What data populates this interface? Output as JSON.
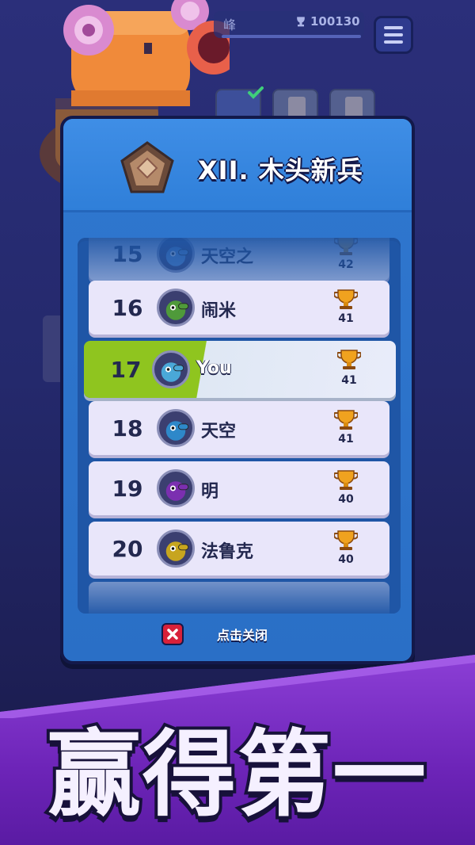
{
  "background": {
    "player_name_partial": "峰",
    "trophy_total": "100130"
  },
  "panel": {
    "title": "XII. 木头新兵",
    "close_label": "点击关闭"
  },
  "leaderboard": {
    "rows": [
      {
        "rank": "15",
        "name": "天空之",
        "score": "42",
        "avatar_color": "#5c8fd0"
      },
      {
        "rank": "16",
        "name": "闹米",
        "score": "41",
        "avatar_color": "#4f9a3a"
      },
      {
        "rank": "17",
        "name": "You",
        "score": "41",
        "avatar_color": "#4aa8d8"
      },
      {
        "rank": "18",
        "name": "天空",
        "score": "41",
        "avatar_color": "#2e88c9"
      },
      {
        "rank": "19",
        "name": "明",
        "score": "40",
        "avatar_color": "#7b2fb0"
      },
      {
        "rank": "20",
        "name": "法鲁克",
        "score": "40",
        "avatar_color": "#c7a51f"
      }
    ]
  },
  "banner": {
    "slogan": "赢得第一"
  },
  "colors": {
    "you_highlight": "#8fc51f",
    "panel_blue": "#2f77cf",
    "banner_purple": "#7a2fc6",
    "close_red": "#d8213a"
  }
}
